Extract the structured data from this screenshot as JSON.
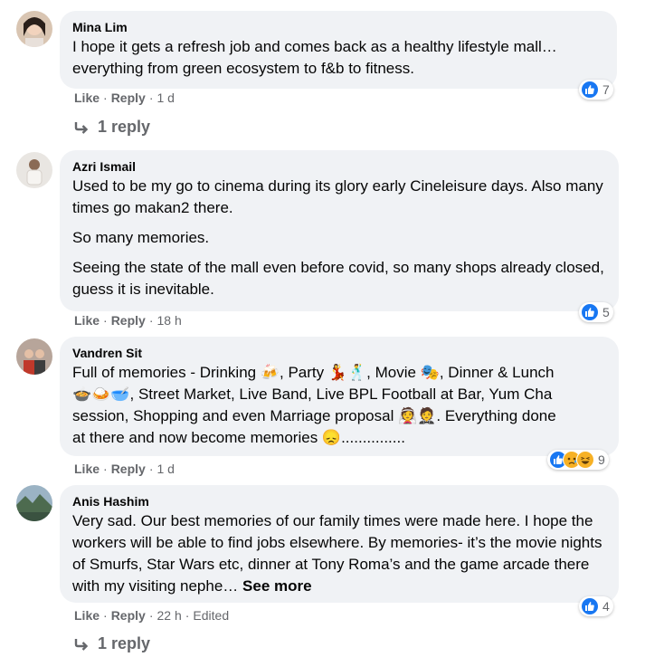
{
  "comments": [
    {
      "author": "Mina Lim",
      "paragraphs": [
        "I hope it gets a refresh job and comes back as a healthy lifestyle mall… everything from green ecosystem to f&b to fitness."
      ],
      "like_label": "Like",
      "reply_label": "Reply",
      "time": "1 d",
      "reaction_count": "7",
      "replies_label": "1 reply"
    },
    {
      "author": "Azri Ismail",
      "paragraphs": [
        "Used to be my go to cinema during its glory early Cineleisure days. Also many times go makan2 there.",
        "So many memories.",
        "Seeing the state of the mall even before covid, so many shops already closed, guess it is inevitable."
      ],
      "like_label": "Like",
      "reply_label": "Reply",
      "time": "18 h",
      "reaction_count": "5"
    },
    {
      "author": "Vandren Sit",
      "line1": "Full of memories - Drinking 🍻, Party 💃🕺, Movie 🎭, Dinner & Lunch",
      "line2": "🍲🍛🥣, Street Market, Live Band, Live BPL Football at Bar, Yum Cha",
      "line3": "session, Shopping and even Marriage proposal 👰🤵. Everything done",
      "line4": "at there and now become memories 😞...............",
      "like_label": "Like",
      "reply_label": "Reply",
      "time": "1 d",
      "reaction_count": "9"
    },
    {
      "author": "Anis Hashim",
      "paragraph": "Very sad. Our best memories of our family times were made here. I hope the workers will be able to find jobs elsewhere. By memories- it’s the movie nights of Smurfs, Star Wars etc, dinner at Tony Roma’s and the game arcade there with my visiting nephe…",
      "see_more": "See more",
      "like_label": "Like",
      "reply_label": "Reply",
      "time": "22 h",
      "edited": "Edited",
      "reaction_count": "4",
      "replies_label": "1 reply"
    }
  ],
  "colors": {
    "bubble": "#f0f2f5",
    "like_blue": "#1877f2",
    "meta_gray": "#65676b"
  }
}
